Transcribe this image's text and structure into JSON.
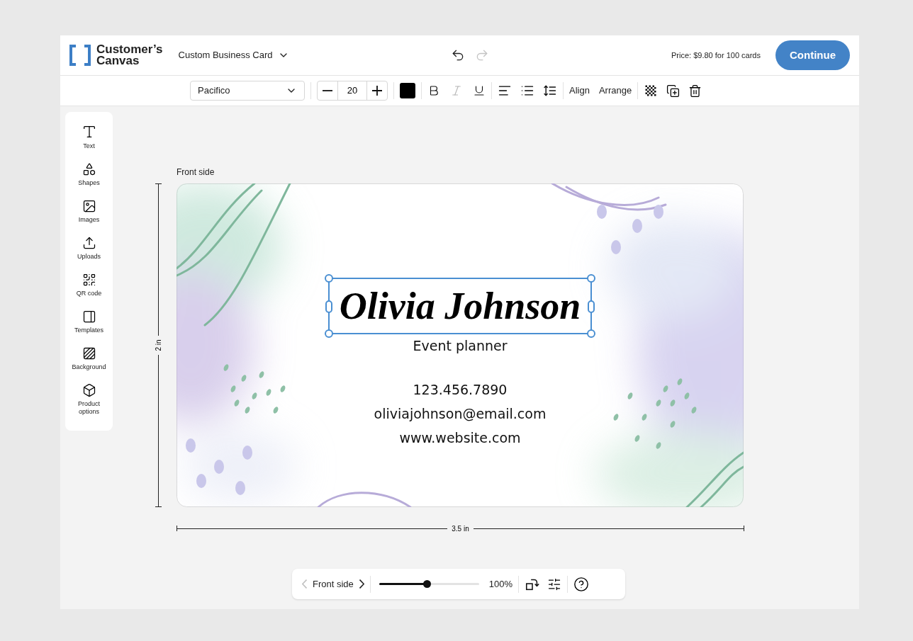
{
  "header": {
    "logo": {
      "line1": "Customer’s",
      "line2": "Canvas"
    },
    "product": "Custom Business Card",
    "undo": {
      "disabled": false
    },
    "redo": {
      "disabled": true
    },
    "price": "Price: $9.80 for 100 cards",
    "continue": "Continue"
  },
  "toolbar": {
    "font": "Pacifico",
    "size": "20",
    "color": "#000000",
    "format": [
      {
        "kind": "bold",
        "disabled": false
      },
      {
        "kind": "italic",
        "disabled": true
      },
      {
        "kind": "underline",
        "disabled": false
      }
    ],
    "align": "Align",
    "arrange": "Arrange"
  },
  "sidebar": [
    {
      "kind": "text",
      "label": "Text"
    },
    {
      "kind": "shapes",
      "label": "Shapes"
    },
    {
      "kind": "images",
      "label": "Images"
    },
    {
      "kind": "uploads",
      "label": "Uploads"
    },
    {
      "kind": "qr",
      "label": "QR code"
    },
    {
      "kind": "templates",
      "label": "Templates"
    },
    {
      "kind": "background",
      "label": "Background"
    },
    {
      "kind": "product",
      "label": "Product options"
    }
  ],
  "canvas": {
    "side_label": "Front side",
    "height_label": "2 in",
    "width_label": "3.5 in",
    "card": {
      "name": "Olivia Johnson",
      "name_selected": true,
      "title": "Event planner",
      "lines": [
        "123.456.7890",
        "oliviajohnson@email.com",
        "www.website.com"
      ]
    }
  },
  "bottom_bar": {
    "side": "Front side",
    "prev_disabled": true,
    "next_disabled": false,
    "zoom": {
      "level": 0.48,
      "reading": "100%"
    }
  }
}
